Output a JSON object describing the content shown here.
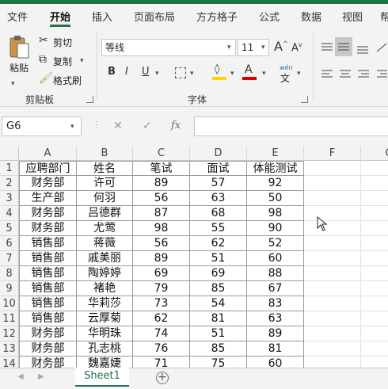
{
  "menu": [
    "文件",
    "开始",
    "插入",
    "页面布局",
    "方方格子",
    "公式",
    "数据",
    "视图",
    "帮"
  ],
  "ribbon": {
    "paste": "粘贴",
    "cut": "剪切",
    "copy": "复制",
    "format_painter": "格式刷",
    "clipboard_group": "剪贴板",
    "font_name": "等线",
    "font_size": "11",
    "font_group": "字体",
    "bold": "B",
    "italic": "I",
    "underline": "U",
    "grow_font": "A",
    "shrink_font": "A",
    "wen": "wén",
    "wen2": "文",
    "font_color_letter": "A",
    "highlight_color": "#ffd400",
    "font_color": "#e00000"
  },
  "formula_bar": {
    "name_box": "G6",
    "cancel": "✕",
    "enter": "✓",
    "fx": "fx",
    "value": ""
  },
  "columns": [
    "A",
    "B",
    "C",
    "D",
    "E",
    "F",
    "G"
  ],
  "rows": [
    [
      "应聘部门",
      "姓名",
      "笔试",
      "面试",
      "体能测试"
    ],
    [
      "财务部",
      "许可",
      "89",
      "57",
      "92"
    ],
    [
      "生产部",
      "何羽",
      "56",
      "63",
      "50"
    ],
    [
      "财务部",
      "吕德群",
      "87",
      "68",
      "98"
    ],
    [
      "财务部",
      "尤莺",
      "98",
      "55",
      "90"
    ],
    [
      "销售部",
      "蒋薇",
      "56",
      "62",
      "52"
    ],
    [
      "销售部",
      "戚美丽",
      "89",
      "51",
      "60"
    ],
    [
      "销售部",
      "陶婷婷",
      "69",
      "69",
      "88"
    ],
    [
      "销售部",
      "褚艳",
      "79",
      "85",
      "67"
    ],
    [
      "销售部",
      "华莉莎",
      "73",
      "54",
      "83"
    ],
    [
      "销售部",
      "云厚菊",
      "62",
      "81",
      "63"
    ],
    [
      "财务部",
      "华明珠",
      "74",
      "51",
      "89"
    ],
    [
      "财务部",
      "孔志桃",
      "76",
      "85",
      "81"
    ],
    [
      "财务部",
      "魏嘉婕",
      "71",
      "75",
      "60"
    ]
  ],
  "sheet_tab": "Sheet1",
  "add_sheet": "+"
}
